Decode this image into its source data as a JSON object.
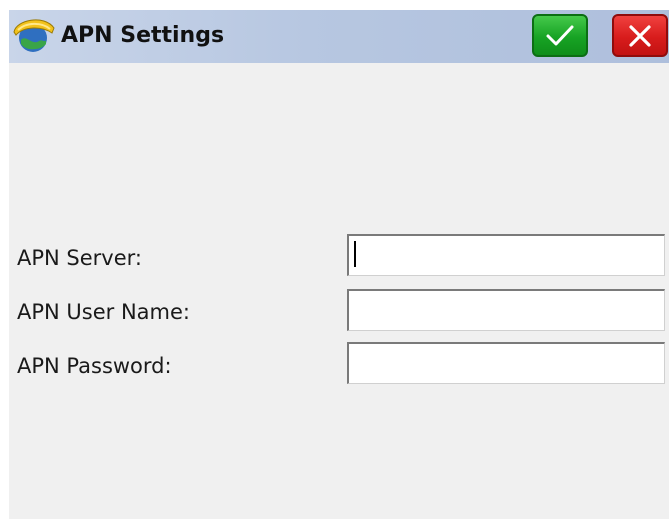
{
  "window": {
    "title": "APN Settings",
    "app_icon": "survey-helmet-globe-icon",
    "ok_icon": "check-icon",
    "cancel_icon": "close-icon",
    "ok_color": "#17a324",
    "cancel_color": "#d81c1c",
    "titlebar_color": "#b7c7e1"
  },
  "form": {
    "apn_server": {
      "label": "APN Server:",
      "value": ""
    },
    "apn_user_name": {
      "label": "APN User Name:",
      "value": ""
    },
    "apn_password": {
      "label": "APN Password:",
      "value": ""
    }
  }
}
